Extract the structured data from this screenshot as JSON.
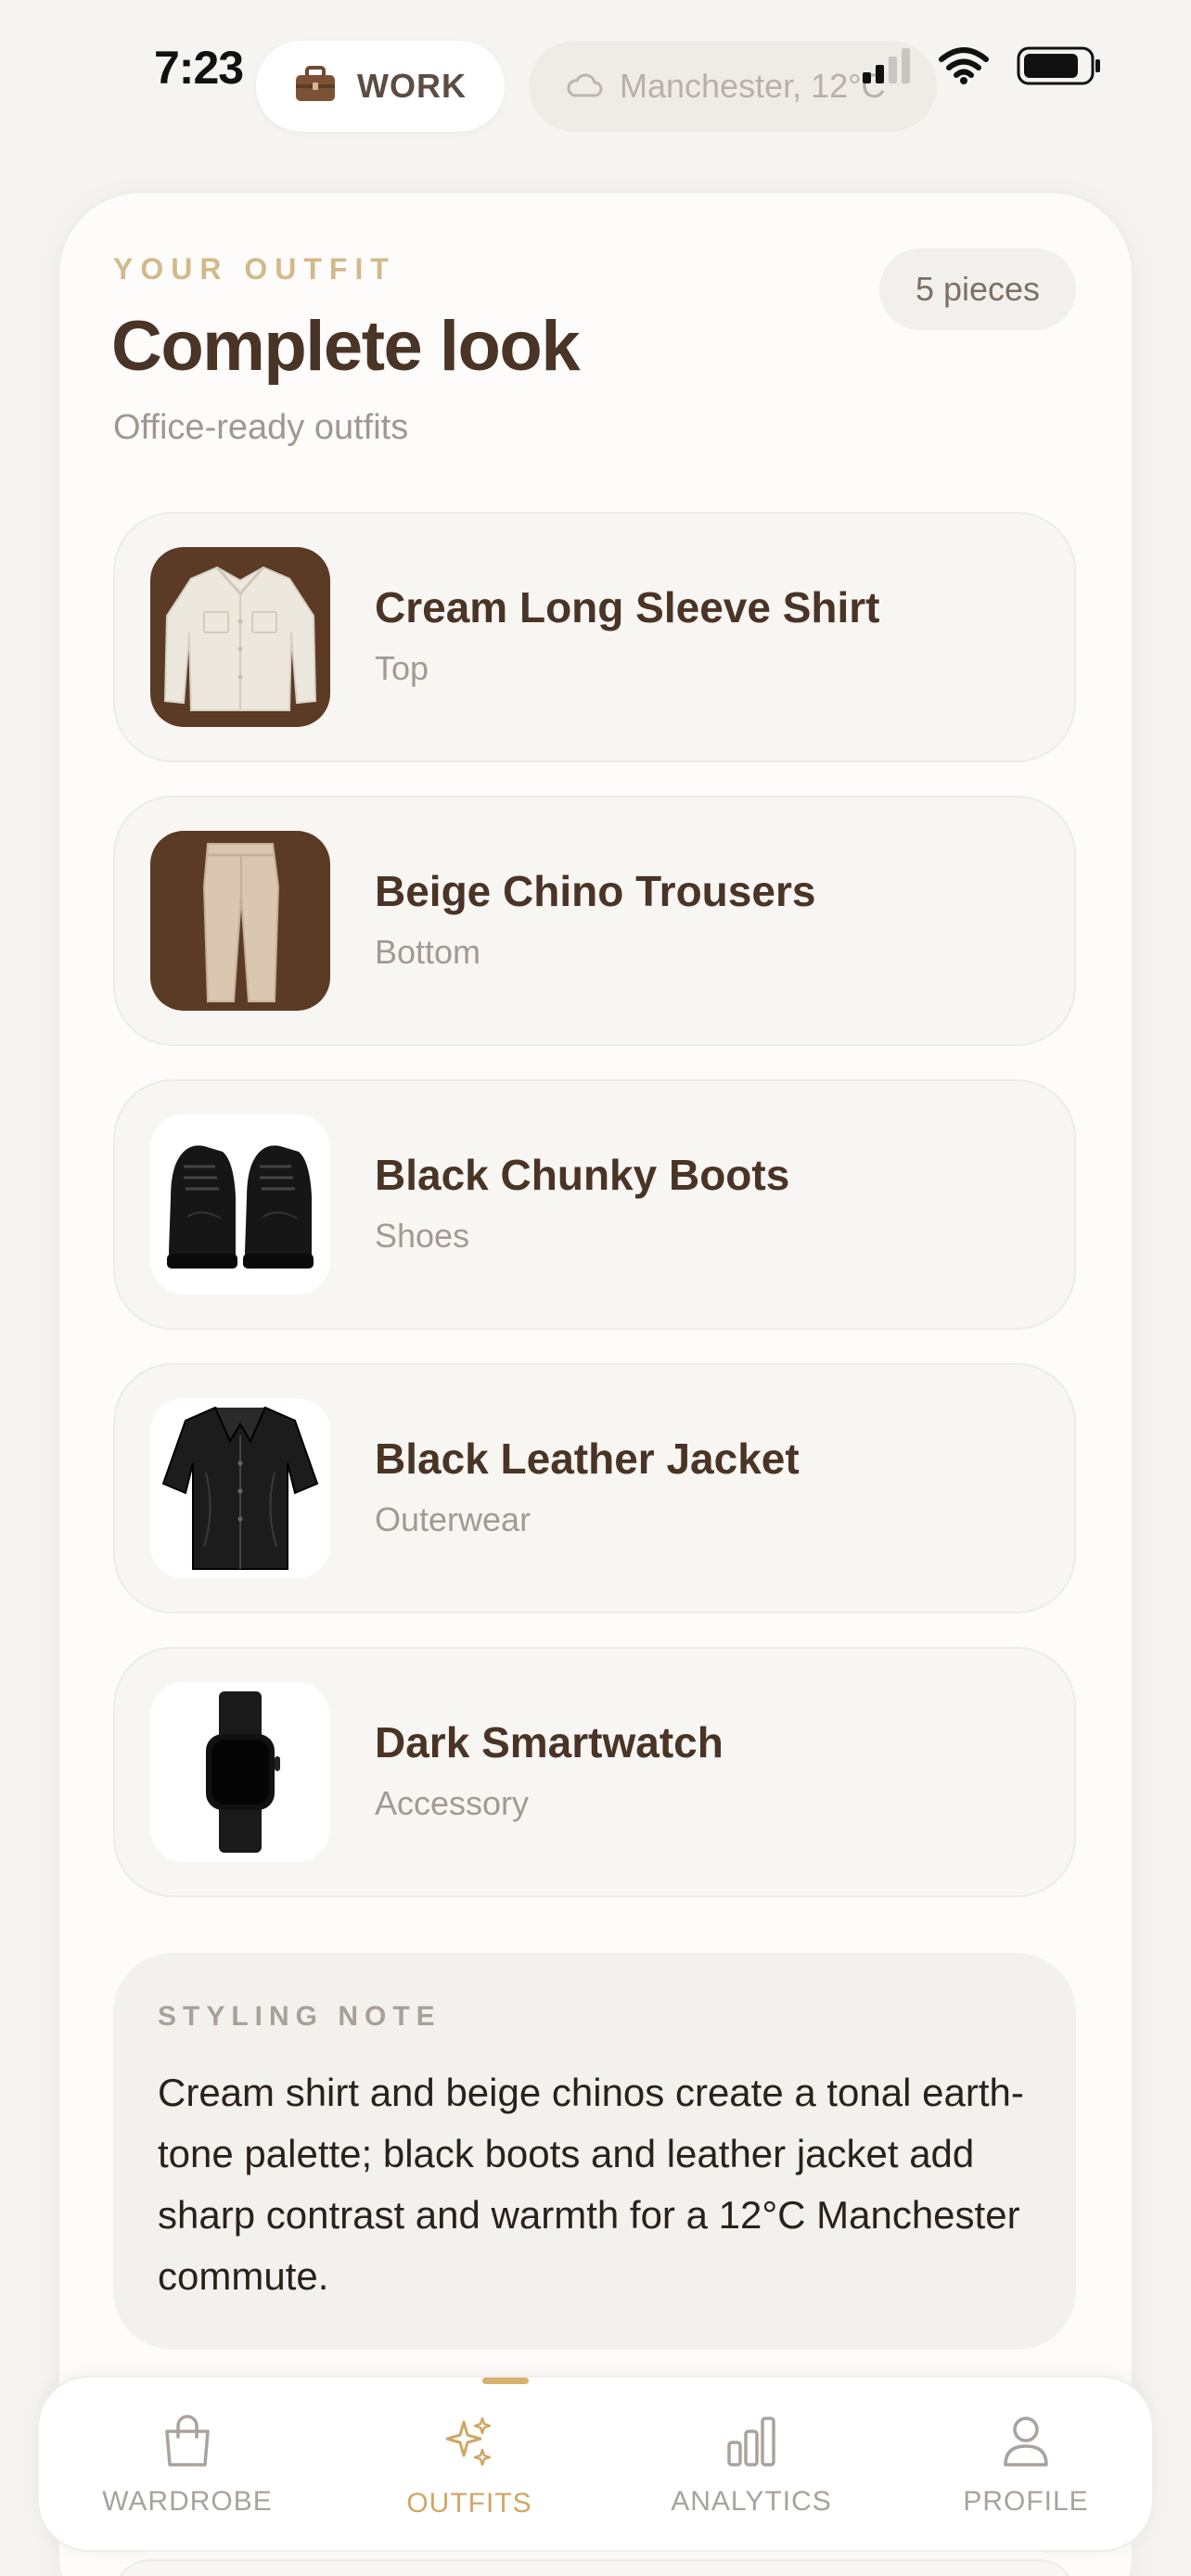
{
  "status_bar": {
    "time": "7:23"
  },
  "context": {
    "mode_label": "WORK",
    "weather_label": "Manchester, 12°C"
  },
  "outfit": {
    "eyebrow": "YOUR OUTFIT",
    "title": "Complete look",
    "subtitle": "Office-ready outfits",
    "count_label": "5 pieces",
    "items": [
      {
        "name": "Cream Long Sleeve Shirt",
        "category": "Top",
        "icon": "shirt-icon"
      },
      {
        "name": "Beige Chino Trousers",
        "category": "Bottom",
        "icon": "trousers-icon"
      },
      {
        "name": "Black Chunky Boots",
        "category": "Shoes",
        "icon": "boots-icon"
      },
      {
        "name": "Black Leather Jacket",
        "category": "Outerwear",
        "icon": "jacket-icon"
      },
      {
        "name": "Dark Smartwatch",
        "category": "Accessory",
        "icon": "smartwatch-icon"
      }
    ]
  },
  "styling_note": {
    "eyebrow": "STYLING NOTE",
    "text": "Cream shirt and beige chinos create a tonal earth-tone palette; black boots and leather jacket add sharp contrast and warmth for a 12°C Manchester commute."
  },
  "tab_bar": {
    "active": "outfits",
    "tabs": [
      {
        "id": "wardrobe",
        "label": "WARDROBE",
        "icon": "shopping-bag-icon"
      },
      {
        "id": "outfits",
        "label": "OUTFITS",
        "icon": "sparkles-icon"
      },
      {
        "id": "analytics",
        "label": "ANALYTICS",
        "icon": "bar-chart-icon"
      },
      {
        "id": "profile",
        "label": "PROFILE",
        "icon": "person-icon"
      }
    ]
  },
  "colors": {
    "accent": "#cfa763",
    "brown": "#4a3426",
    "background": "#f6f4f1"
  }
}
